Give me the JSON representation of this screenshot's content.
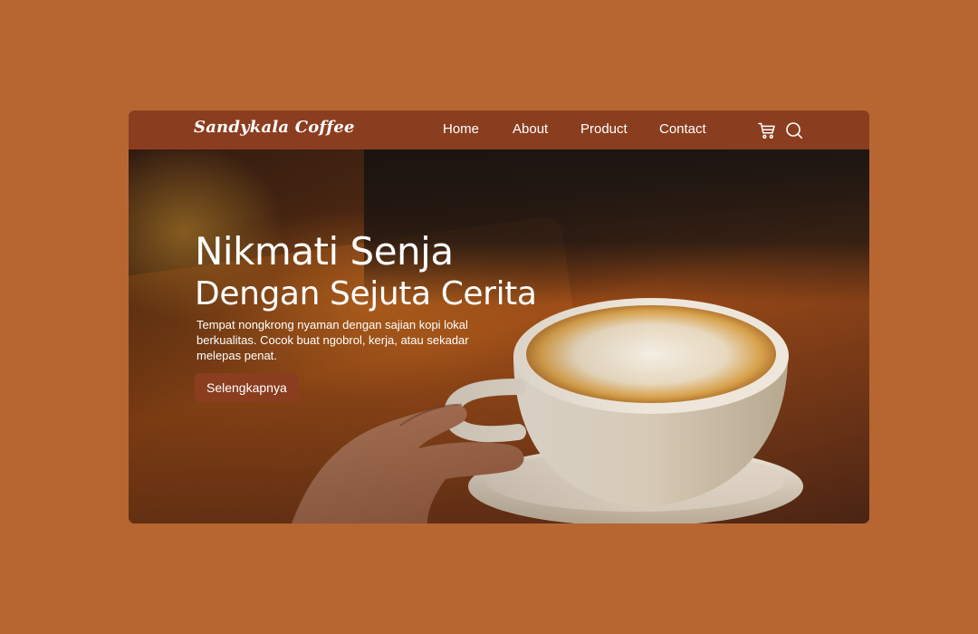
{
  "brand": {
    "name": "Sandykala Coffee"
  },
  "nav": {
    "items": [
      {
        "label": "Home"
      },
      {
        "label": "About"
      },
      {
        "label": "Product"
      },
      {
        "label": "Contact"
      }
    ],
    "icons": [
      "cart-icon",
      "search-icon"
    ]
  },
  "hero": {
    "title_line1": "Nikmati Senja",
    "title_line2": "Dengan Sejuta Cerita",
    "description": "Tempat nongkrong nyaman dengan sajian kopi lokal berkualitas. Cocok buat ngobrol, kerja, atau sekadar melepas penat.",
    "cta_label": "Selengkapnya",
    "image": "cappuccino-cup-photo"
  },
  "colors": {
    "page_background": "#b76632",
    "navbar": "#8b3e1f",
    "button": "#8b3e1f",
    "text": "#ffffff"
  }
}
